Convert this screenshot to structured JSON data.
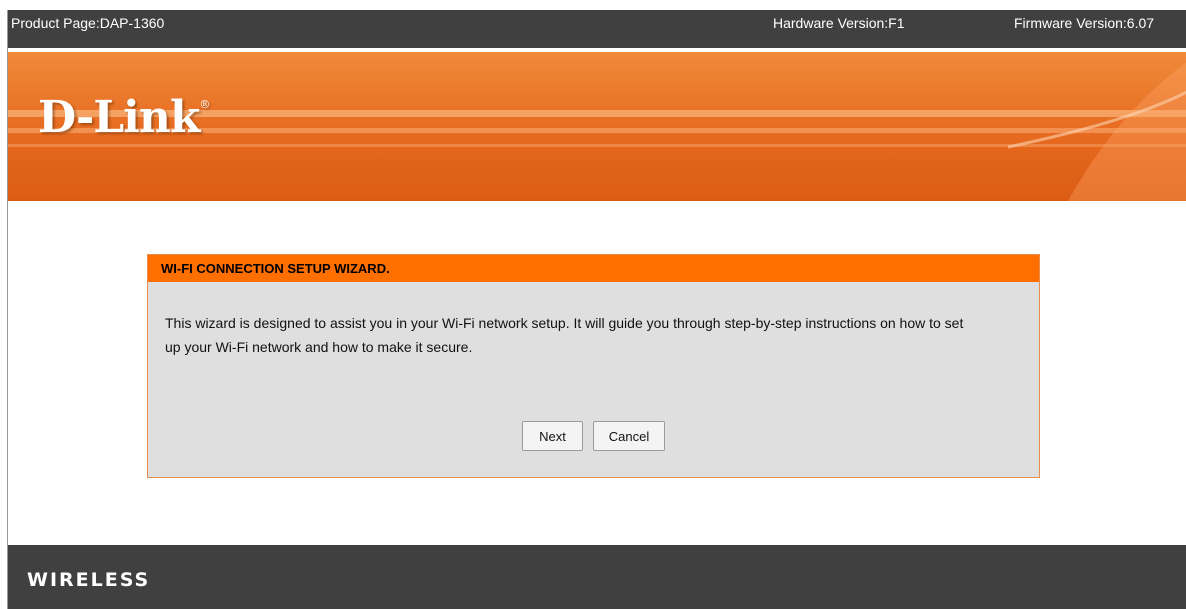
{
  "topbar": {
    "product": "Product Page:DAP-1360",
    "hardware": "Hardware Version:F1",
    "firmware": "Firmware Version:6.07"
  },
  "brand": {
    "logo_text": "D-Link",
    "registered_mark": "®"
  },
  "wizard": {
    "title": "WI-FI CONNECTION SETUP WIZARD.",
    "description": "This wizard is designed to assist you in your Wi-Fi network setup. It will guide you through step-by-step instructions on how to set up your Wi-Fi network and how to make it secure.",
    "next_label": "Next",
    "cancel_label": "Cancel"
  },
  "footer": {
    "label": "WIRELESS"
  },
  "colors": {
    "accent": "#ff6f00",
    "bar": "#404040",
    "panel": "#dfdfdf"
  }
}
